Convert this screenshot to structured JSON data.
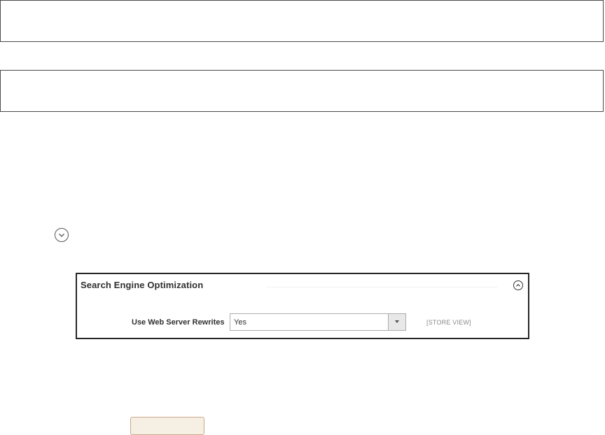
{
  "seo_section": {
    "title": "Search Engine Optimization",
    "field": {
      "label": "Use Web Server Rewrites",
      "value": "Yes",
      "scope": "[STORE VIEW]"
    }
  },
  "save_button": {
    "label": ""
  },
  "icons": {
    "expand_toggle": "chevron-down-circle-icon",
    "collapse_toggle": "chevron-up-circle-icon",
    "select_arrow": "caret-down-icon"
  }
}
